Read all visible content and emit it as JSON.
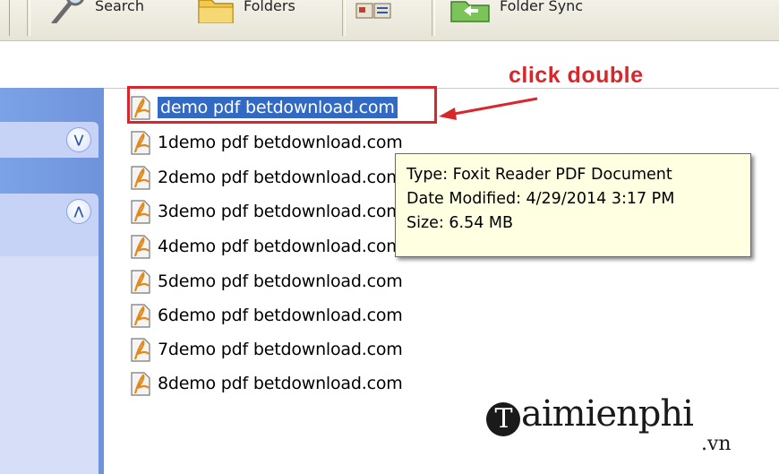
{
  "toolbar": {
    "search_label": "Search",
    "folders_label": "Folders",
    "folder_sync_label": "Folder Sync"
  },
  "files": [
    {
      "name": "demo pdf betdownload.com",
      "selected": true
    },
    {
      "name": "1demo pdf betdownload.com"
    },
    {
      "name": "2demo pdf betdownload.com"
    },
    {
      "name": "3demo pdf betdownload.com"
    },
    {
      "name": "4demo pdf betdownload.com"
    },
    {
      "name": "5demo pdf betdownload.com"
    },
    {
      "name": "6demo pdf betdownload.com"
    },
    {
      "name": "7demo pdf betdownload.com"
    },
    {
      "name": "8demo pdf betdownload.com"
    }
  ],
  "annotation": {
    "label": "click double",
    "color": "#d9262b"
  },
  "tooltip": {
    "type": "Type: Foxit Reader PDF Document",
    "modified": "Date Modified: 4/29/2014 3:17 PM",
    "size": "Size: 6.54 MB"
  },
  "watermark": {
    "brand_initial": "T",
    "brand_rest": "aimienphi",
    "domain": ".vn"
  },
  "colors": {
    "selection": "#316ac5",
    "taskpane": "#7ba2e7",
    "tooltip_bg": "#ffffe1"
  }
}
